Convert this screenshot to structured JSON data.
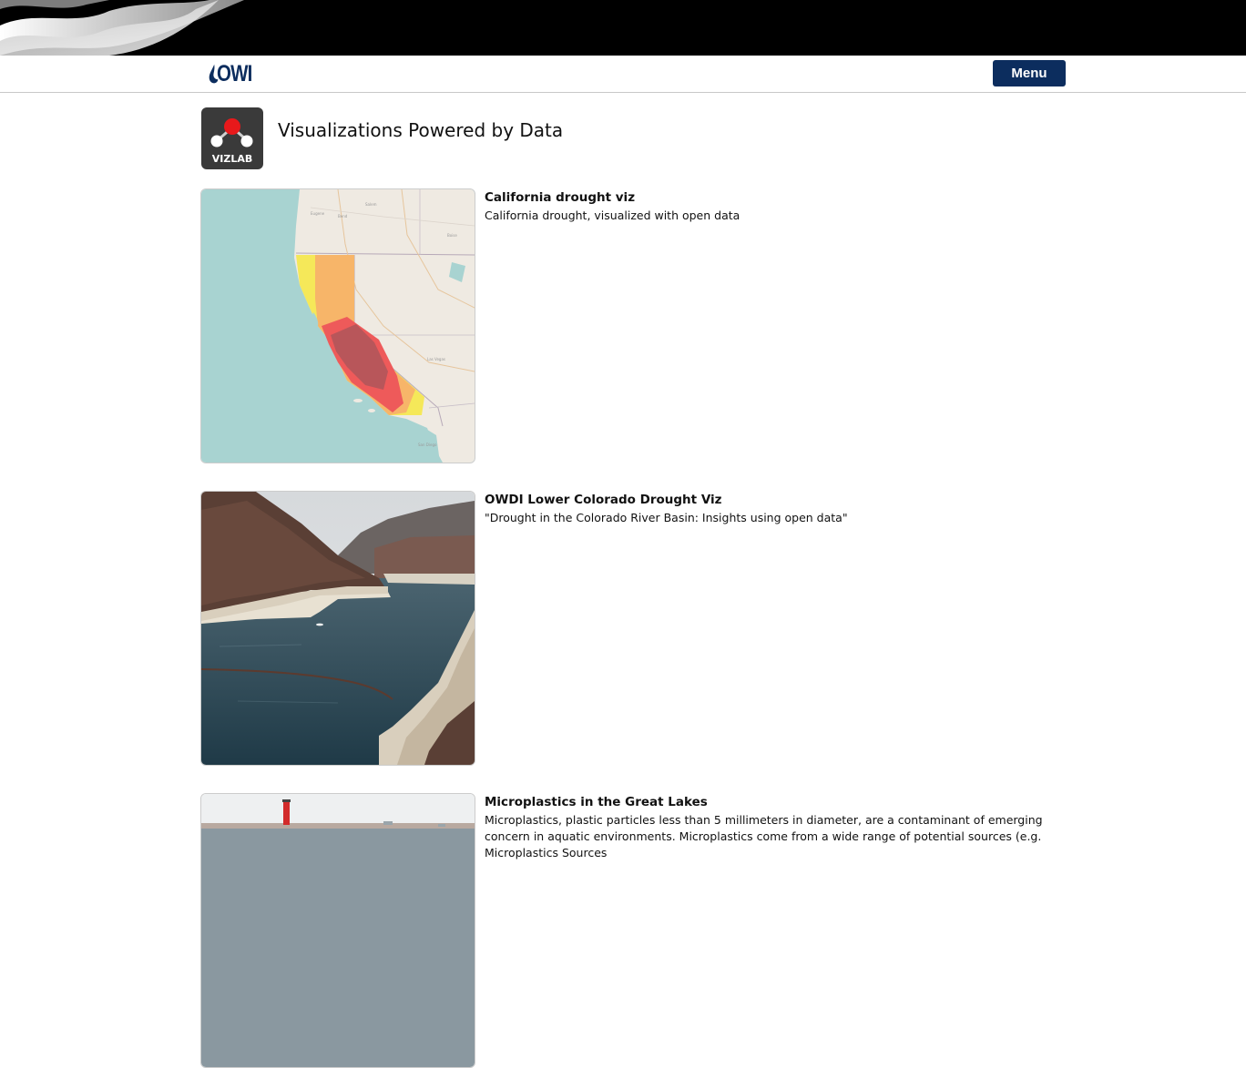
{
  "header": {
    "logo_text": "OWI",
    "menu_label": "Menu"
  },
  "page": {
    "badge_label": "VIZLAB",
    "title": "Visualizations Powered by Data"
  },
  "cards": [
    {
      "title": "California drought viz",
      "description": "California drought, visualized with open data",
      "thumbnail": "california-drought-map"
    },
    {
      "title": "OWDI Lower Colorado Drought Viz",
      "description": "\"Drought in the Colorado River Basin: Insights using open data\"",
      "thumbnail": "lake-mead-photo"
    },
    {
      "title": "Microplastics in the Great Lakes",
      "description": "Microplastics, plastic particles less than 5 millimeters in diameter, are a contaminant of emerging concern in aquatic environments. Microplastics come from a wide range of potential sources (e.g. Microplastics Sources",
      "thumbnail": "great-lakes-lighthouse-photo"
    }
  ],
  "colors": {
    "brand_navy": "#0c2d5e",
    "banner_black": "#000000",
    "drought_yellow": "#f5e84a",
    "drought_orange": "#f7b26a",
    "drought_red": "#ee5a5a",
    "drought_darkred": "#b8565a",
    "ocean": "#a8d3d1"
  }
}
